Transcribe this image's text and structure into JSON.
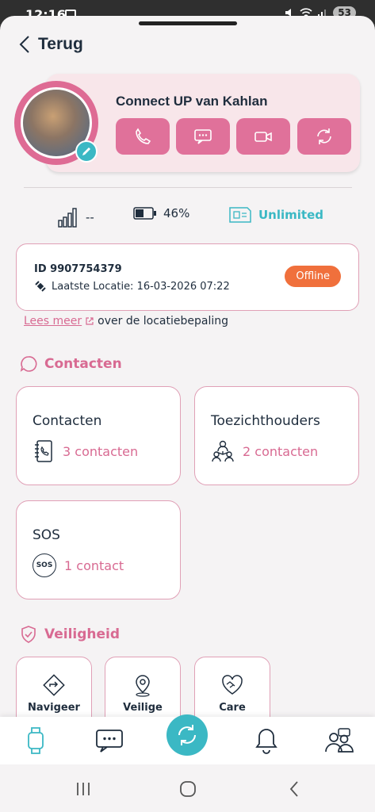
{
  "statusbar": {
    "time": "12:16",
    "battery": "53"
  },
  "header": {
    "back_label": "Terug"
  },
  "profile": {
    "name": "Connect UP van Kahlan",
    "actions": [
      "phone-icon",
      "message-icon",
      "video-icon",
      "sync-icon"
    ]
  },
  "stats": {
    "signal": "--",
    "battery": "46%",
    "plan": "Unlimited"
  },
  "device": {
    "id": "ID 9907754379",
    "last_location": "Laatste Locatie: 16-03-2026 07:22",
    "status": "Offline"
  },
  "info": {
    "link": "Lees meer",
    "rest": "over de locatiebepaling"
  },
  "contacts_section": {
    "title": "Contacten",
    "tiles": [
      {
        "title": "Contacten",
        "count": "3 contacten"
      },
      {
        "title": "Toezichthouders",
        "count": "2 contacten"
      },
      {
        "title": "SOS",
        "count": "1 contact",
        "badge": "SOS"
      }
    ]
  },
  "safety_section": {
    "title": "Veiligheid",
    "tiles": [
      {
        "label": "Navigeer"
      },
      {
        "label": "Veilige"
      },
      {
        "label": "Care"
      }
    ]
  },
  "colors": {
    "accent": "#d86a92",
    "teal": "#3bb8c4",
    "offline": "#f0703c"
  }
}
